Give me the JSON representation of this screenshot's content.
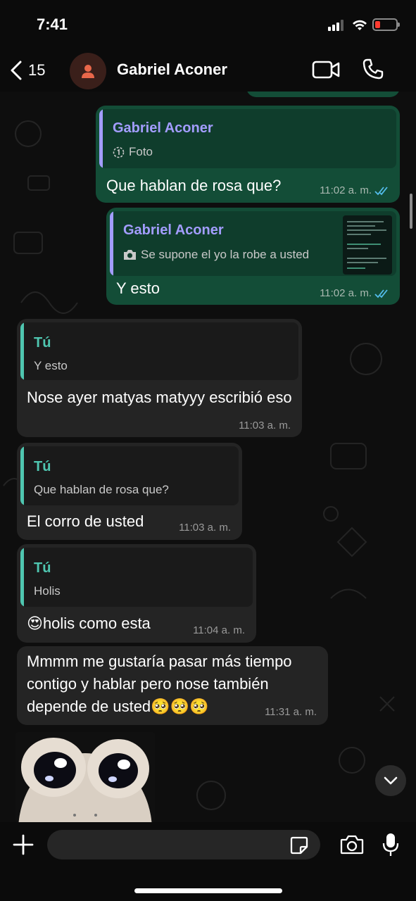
{
  "status_bar": {
    "time": "7:41"
  },
  "header": {
    "back_count": "15",
    "contact_name": "Gabriel Aconer"
  },
  "messages": [
    {
      "direction": "outgoing",
      "quote_author": "Gabriel Aconer",
      "quote_text": "Foto",
      "quote_icon": "view-once-icon",
      "text": "Que hablan de rosa que?",
      "time": "11:02 a. m.",
      "status": "read"
    },
    {
      "direction": "outgoing",
      "quote_author": "Gabriel Aconer",
      "quote_text": "Se supone el yo la robe a usted",
      "quote_icon": "camera-icon",
      "text": "Y esto",
      "time": "11:02 a. m.",
      "status": "read"
    },
    {
      "direction": "incoming",
      "quote_author": "Tú",
      "quote_text": "Y esto",
      "text": "Nose ayer matyas matyyy escribió eso",
      "time": "11:03 a. m."
    },
    {
      "direction": "incoming",
      "quote_author": "Tú",
      "quote_text": "Que hablan de rosa que?",
      "text": "El corro de usted",
      "time": "11:03 a. m."
    },
    {
      "direction": "incoming",
      "quote_author": "Tú",
      "quote_text": "Holis",
      "text": "holis como esta",
      "emoji_prefix": "😍",
      "time": "11:04 a. m."
    },
    {
      "direction": "incoming",
      "text": "Mmmm me gustaría pasar más tiempo contigo y hablar pero nose también depende de usted",
      "emoji_suffix": "🥺🥺🥺",
      "time": "11:31 a. m."
    }
  ],
  "input": {
    "placeholder": ""
  },
  "colors": {
    "outgoing_bubble": "#134d37",
    "incoming_bubble": "#242424",
    "quote_author_outgoing": "#a39dff",
    "quote_author_incoming": "#4fc6b0",
    "read_ticks": "#53bdeb",
    "battery_low": "#ff3b30"
  }
}
